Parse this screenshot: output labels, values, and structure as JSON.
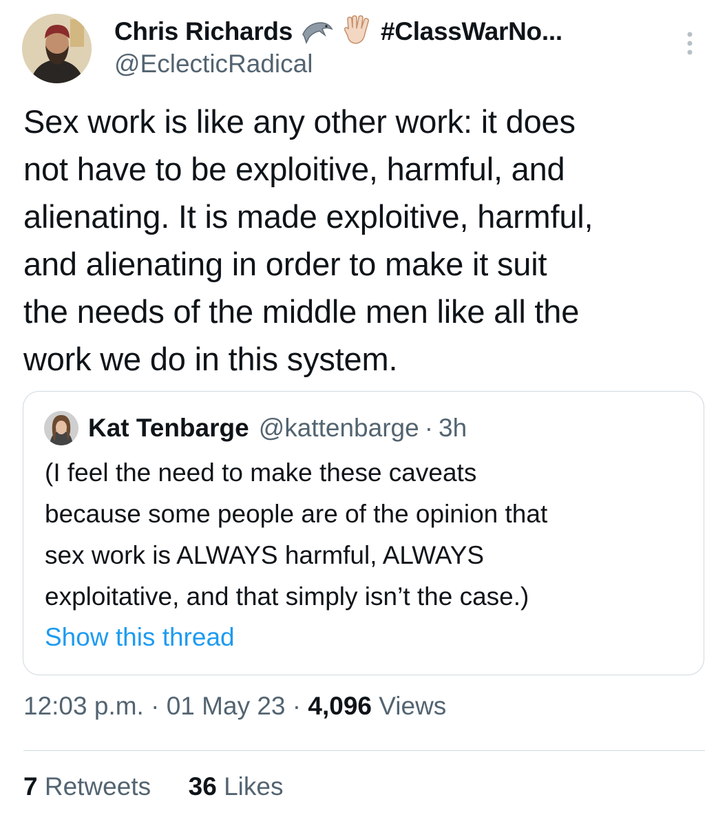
{
  "tweet": {
    "display_name": "Chris Richards",
    "name_suffix": "#ClassWarNo...",
    "name_emojis": [
      "dolphin-icon",
      "vulcan-salute-icon"
    ],
    "handle": "@EclecticRadical",
    "text": "Sex work is like any other work: it does\nnot have to be exploitive, harmful, and\nalienating. It is made exploitive, harmful,\nand alienating in order to make it suit\nthe needs of the middle men like all the\nwork we do in this system.",
    "quoted": {
      "display_name": "Kat Tenbarge",
      "handle": "@kattenbarge",
      "separator": "·",
      "age": "3h",
      "text": "(I feel the need to make these caveats\nbecause some people are of the opinion that\nsex work is ALWAYS harmful, ALWAYS\nexploitative, and that simply isn’t the case.)",
      "show_thread_label": "Show this thread"
    },
    "meta": {
      "time": "12:03 p.m.",
      "separator": "·",
      "date": "01 May 23",
      "views_count": "4,096",
      "views_label": "Views"
    },
    "stats": {
      "retweets_count": "7",
      "retweets_label": "Retweets",
      "likes_count": "36",
      "likes_label": "Likes"
    }
  },
  "colors": {
    "text_primary": "#0f1419",
    "text_secondary": "#536471",
    "link": "#1d9bf0",
    "border": "#cfd9de",
    "background": "#ffffff"
  }
}
